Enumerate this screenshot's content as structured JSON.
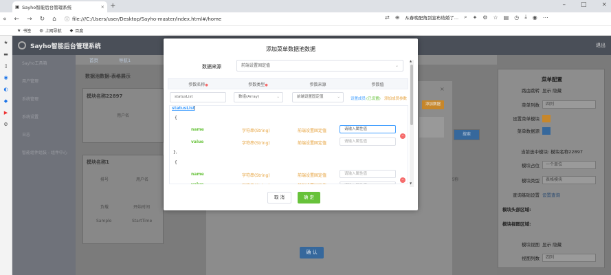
{
  "browser": {
    "tab_title": "Sayho智能后台管理系统",
    "url": "file:///C:/Users/user/Desktop/Sayho-master/index.html#/home",
    "related_search": "从春晚配角到宣布结婚了...",
    "bookmarks": [
      "书签",
      "上网导航",
      "百度"
    ]
  },
  "app": {
    "title": "Sayho智能后台管理系统",
    "exit_label": "退出",
    "sidebar": [
      "Sayho工具箱",
      "用户管理",
      "系统管理",
      "系统设置",
      "日志",
      "智能组件组装 - 组件中心"
    ],
    "crumbs": [
      "首页",
      "导航1"
    ],
    "page_title": "数据池数据-表格展示",
    "module1": "模块名称22897",
    "module2": "模块名称1",
    "bg_text": {
      "username": "用户名",
      "seq": "排号",
      "user": "用户名",
      "name": "名称",
      "owner": "负载",
      "start": "开始时间",
      "sample": "Sample",
      "start_time": "StartTime",
      "search": "搜索"
    }
  },
  "right_panel": {
    "title": "菜单配置",
    "rows": [
      {
        "label": "路由跳转",
        "value": "显示  隐藏"
      },
      {
        "label": "菜单列数",
        "value": "四列"
      },
      {
        "label": "设置菜单模块",
        "value": ""
      },
      {
        "label": "菜单数据源",
        "value": ""
      },
      {
        "label": "当前选中模块: 模块名称22897",
        "value": ""
      },
      {
        "label": "模块占位",
        "value": "一个单位"
      },
      {
        "label": "模块类型",
        "value": "表格模块"
      },
      {
        "label": "查询基础设置",
        "value": "设置查询"
      },
      {
        "label": "模块头部区域:",
        "value": ""
      },
      {
        "label": "模块视图区域:",
        "value": ""
      },
      {
        "label": "模块视图",
        "value": "显示  隐藏"
      },
      {
        "label": "视图列数",
        "value": "四列"
      }
    ]
  },
  "modal2": {
    "close": "×",
    "add_button": "添加数据",
    "ok_button": "确 认"
  },
  "dialog": {
    "title": "添加菜单数据池数据",
    "source_label": "数据来源",
    "source_value": "前端设置固定值",
    "table_headers": [
      "参数名称",
      "参数类型",
      "参数来源",
      "参数值"
    ],
    "row": {
      "name": "statusList",
      "type": "数组(Array)",
      "source": "前端设置固定值",
      "link_set": "设置成员",
      "link_set_status": "(已设置)",
      "link_add": "添加成员参数"
    },
    "tree": {
      "root": "statusList",
      "open_bracket": "[",
      "open_brace": "{",
      "close_brace": "},",
      "fields": [
        {
          "name": "name",
          "type": "字符串(String)",
          "source": "前端设置固定值",
          "placeholder": "请输入属性值"
        },
        {
          "name": "value",
          "type": "字符串(String)",
          "source": "前端设置固定值",
          "placeholder": "请输入属性值"
        },
        {
          "name": "name",
          "type": "字符串(String)",
          "source": "前端设置固定值",
          "placeholder": "请输入属性值"
        },
        {
          "name": "value",
          "type": "字符串(String)",
          "source": "前端设置固定值",
          "placeholder": "请输入属性值"
        }
      ]
    },
    "cancel_button": "取 消",
    "confirm_button": "确 定"
  }
}
